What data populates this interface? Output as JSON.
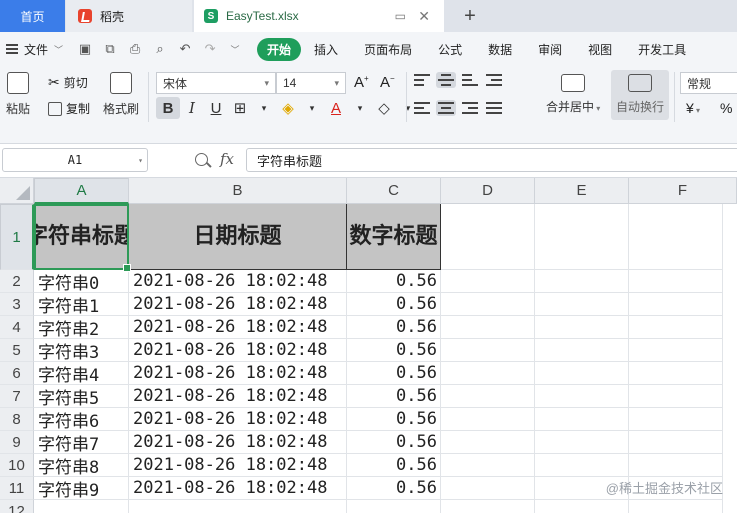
{
  "tabs": {
    "home": "首页",
    "docer": "稻壳",
    "file": "EasyTest.xlsx"
  },
  "menu": {
    "file": "文件",
    "tabs": [
      "开始",
      "插入",
      "页面布局",
      "公式",
      "数据",
      "审阅",
      "视图",
      "开发工具"
    ]
  },
  "ribbon": {
    "paste": "粘贴",
    "cut": "剪切",
    "copy": "复制",
    "format_painter": "格式刷",
    "font": "宋体",
    "font_size": "14",
    "grow_font": "A",
    "shrink_font": "A",
    "bold": "B",
    "italic": "I",
    "underline": "U",
    "merge_center": "合并居中",
    "wrap_text": "自动换行",
    "number_format": "常规",
    "currency": "¥",
    "percent": "%"
  },
  "formula_bar": {
    "name_box": "A1",
    "fx": "fx",
    "value": "字符串标题"
  },
  "sheet": {
    "columns": [
      "A",
      "B",
      "C",
      "D",
      "E",
      "F"
    ],
    "selected_column": "A",
    "row_numbers": [
      "1",
      "2",
      "3",
      "4",
      "5",
      "6",
      "7",
      "8",
      "9",
      "10",
      "11",
      "12"
    ],
    "header": [
      "字符串标题",
      "日期标题",
      "数字标题"
    ],
    "rows": [
      [
        "字符串0",
        "2021-08-26 18:02:48",
        "0.56"
      ],
      [
        "字符串1",
        "2021-08-26 18:02:48",
        "0.56"
      ],
      [
        "字符串2",
        "2021-08-26 18:02:48",
        "0.56"
      ],
      [
        "字符串3",
        "2021-08-26 18:02:48",
        "0.56"
      ],
      [
        "字符串4",
        "2021-08-26 18:02:48",
        "0.56"
      ],
      [
        "字符串5",
        "2021-08-26 18:02:48",
        "0.56"
      ],
      [
        "字符串6",
        "2021-08-26 18:02:48",
        "0.56"
      ],
      [
        "字符串7",
        "2021-08-26 18:02:48",
        "0.56"
      ],
      [
        "字符串8",
        "2021-08-26 18:02:48",
        "0.56"
      ],
      [
        "字符串9",
        "2021-08-26 18:02:48",
        "0.56"
      ]
    ]
  },
  "watermark": "@稀土掘金技术社区"
}
